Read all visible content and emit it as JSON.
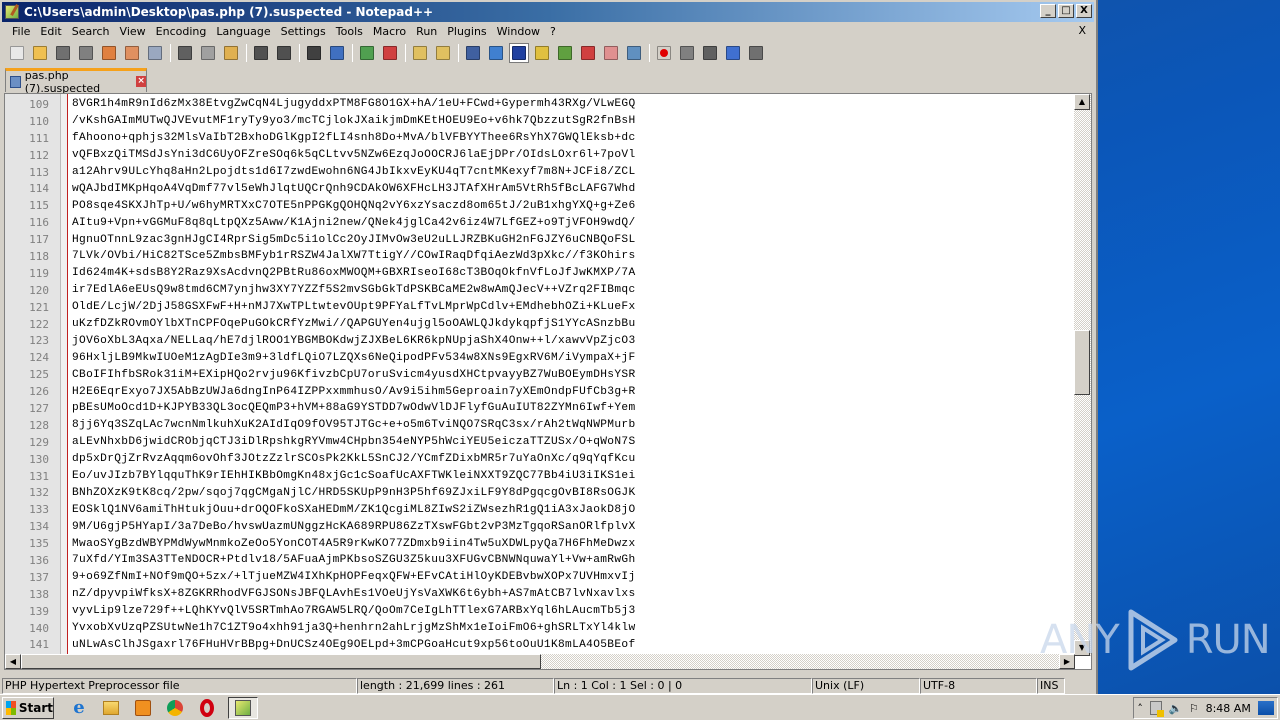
{
  "window": {
    "title": "C:\\Users\\admin\\Desktop\\pas.php (7).suspected - Notepad++",
    "buttons": {
      "minimize": "_",
      "maximize": "□",
      "close": "X"
    }
  },
  "menubar": {
    "items": [
      "File",
      "Edit",
      "Search",
      "View",
      "Encoding",
      "Language",
      "Settings",
      "Tools",
      "Macro",
      "Run",
      "Plugins",
      "Window",
      "?"
    ],
    "close_doc": "X"
  },
  "toolbar": {
    "icons": [
      {
        "name": "new-file-icon",
        "color": "#e8e8e8"
      },
      {
        "name": "open-file-icon",
        "color": "#f0c050"
      },
      {
        "name": "save-icon",
        "color": "#707070"
      },
      {
        "name": "save-all-icon",
        "color": "#808080"
      },
      {
        "name": "close-icon",
        "color": "#e08040"
      },
      {
        "name": "close-all-icon",
        "color": "#e09060"
      },
      {
        "name": "print-icon",
        "color": "#9aa8c0"
      },
      {
        "sep": true
      },
      {
        "name": "cut-icon",
        "color": "#606060"
      },
      {
        "name": "copy-icon",
        "color": "#a0a0a0"
      },
      {
        "name": "paste-icon",
        "color": "#e0b050"
      },
      {
        "sep": true
      },
      {
        "name": "undo-icon",
        "color": "#505050"
      },
      {
        "name": "redo-icon",
        "color": "#505050"
      },
      {
        "sep": true
      },
      {
        "name": "find-icon",
        "color": "#404040"
      },
      {
        "name": "replace-icon",
        "color": "#4070c0"
      },
      {
        "sep": true
      },
      {
        "name": "zoom-in-icon",
        "color": "#50a050"
      },
      {
        "name": "zoom-out-icon",
        "color": "#d04040"
      },
      {
        "sep": true
      },
      {
        "name": "sync-vertical-icon",
        "color": "#e0c060"
      },
      {
        "name": "sync-horizontal-icon",
        "color": "#e0c060"
      },
      {
        "sep": true
      },
      {
        "name": "word-wrap-icon",
        "color": "#4060a0"
      },
      {
        "name": "show-all-chars-icon",
        "color": "#4080d0"
      },
      {
        "name": "indent-guide-icon",
        "color": "#2040a0",
        "active": true
      },
      {
        "name": "user-defined-language-icon",
        "color": "#e0c040"
      },
      {
        "name": "document-map-icon",
        "color": "#60a040"
      },
      {
        "name": "function-list-icon",
        "color": "#d04040"
      },
      {
        "name": "folder-workspace-icon",
        "color": "#e09090"
      },
      {
        "name": "monitoring-icon",
        "color": "#6090c0"
      },
      {
        "sep": true
      },
      {
        "name": "record-macro-icon",
        "color": "#e00000"
      },
      {
        "name": "stop-macro-icon",
        "color": "#808080"
      },
      {
        "name": "play-macro-icon",
        "color": "#606060"
      },
      {
        "name": "run-macro-multiple-icon",
        "color": "#4070d0"
      },
      {
        "name": "save-macro-icon",
        "color": "#707070"
      }
    ]
  },
  "tab": {
    "label": "pas.php (7).suspected",
    "close": "×"
  },
  "editor": {
    "lines": [
      {
        "n": "109",
        "text": "8VGR1h4mR9nId6zMx38EtvgZwCqN4LjugyddxPTM8FG8O1GX+hA/1eU+FCwd+Gypermh43RXg/VLwEGQ"
      },
      {
        "n": "110",
        "text": "/vKshGAImMUTwQJVEvutMF1ryTy9yo3/mcTCjlokJXaikjmDmKEtHOEU9Eo+v6hk7QbzzutSgR2fnBsH"
      },
      {
        "n": "111",
        "text": "fAhoono+qphjs32MlsVaIbT2BxhoDGlKgpI2fLI4snh8Do+MvA/blVFBYYThee6RsYhX7GWQlEksb+dc"
      },
      {
        "n": "112",
        "text": "vQFBxzQiTMSdJsYni3dC6UyOFZreSOq6k5qCLtvv5NZw6EzqJoOOCRJ6laEjDPr/OIdsLOxr6l+7poVl"
      },
      {
        "n": "113",
        "text": "a12Ahrv9ULcYhq8aHn2Lpojdts1d6I7zwdEwohn6NG4JbIkxvEyKU4qT7cntMKexyf7m8N+JCFi8/ZCL"
      },
      {
        "n": "114",
        "text": "wQAJbdIMKpHqoA4VqDmf77vl5eWhJlqtUQCrQnh9CDAkOW6XFHcLH3JTAfXHrAm5VtRh5fBcLAFG7Whd"
      },
      {
        "n": "115",
        "text": "PO8sqe4SKXJhTp+U/w6hyMRTXxC7OTE5nPPGKgQOHQNq2vY6xzYsaczd8om65tJ/2uB1xhgYXQ+g+Ze6"
      },
      {
        "n": "116",
        "text": "AItu9+Vpn+vGGMuF8q8qLtpQXz5Aww/K1Ajni2new/QNek4jglCa42v6iz4W7LfGEZ+o9TjVFOH9wdQ/"
      },
      {
        "n": "117",
        "text": "HgnuOTnnL9zac3gnHJgCI4RprSig5mDc5i1olCc2OyJIMvOw3eU2uLLJRZBKuGH2nFGJZY6uCNBQoFSL"
      },
      {
        "n": "118",
        "text": "7LVk/OVbi/HiC82TSce5ZmbsBMFyb1rRSZW4JalXW7TtigY//COwIRaqDfqiAezWd3pXkc//f3KOhirs"
      },
      {
        "n": "119",
        "text": "Id624m4K+sdsB8Y2Raz9XsAcdvnQ2PBtRu86oxMWOQM+GBXRIseoI68cT3BOqOkfnVfLoJfJwKMXP/7A"
      },
      {
        "n": "120",
        "text": "ir7EdlA6eEUsQ9w8tmd6CM7ynjhw3XY7YZZf5S2mvSGbGkTdPSKBCaME2w8wAmQJecV++VZrq2FIBmqc"
      },
      {
        "n": "121",
        "text": "OldE/LcjW/2DjJ58GSXFwF+H+nMJ7XwTPLtwtevOUpt9PFYaLfTvLMprWpCdlv+EMdhebhOZi+KLueFx"
      },
      {
        "n": "122",
        "text": "uKzfDZkROvmOYlbXTnCPFOqePuGOkCRfYzMwi//QAPGUYen4ujgl5oOAWLQJkdykqpfjS1YYcASnzbBu"
      },
      {
        "n": "123",
        "text": "jOV6oXbL3Aqxa/NELLaq/hE7djlROO1YBGMBOKdwjZJXBeL6KR6kpNUpjaShX4Onw++l/xawvVpZjcO3"
      },
      {
        "n": "124",
        "text": "96HxljLB9MkwIUOeM1zAgDIe3m9+3ldfLQiO7LZQXs6NeQipodPFv534w8XNs9EgxRV6M/iVympaX+jF"
      },
      {
        "n": "125",
        "text": "CBoIFIhfbSRok31iM+EXipHQo2rvju96KfivzbCpU7oruSvicm4yusdXHCtpvayyBZ7WuBOEymDHsYSR"
      },
      {
        "n": "126",
        "text": "H2E6EqrExyo7JX5AbBzUWJa6dngInP64IZPPxxmmhusO/Av9i5ihm5Geproain7yXEmOndpFUfCb3g+R"
      },
      {
        "n": "127",
        "text": "pBEsUMoOcd1D+KJPYB33QL3ocQEQmP3+hVM+88aG9YSTDD7wOdwVlDJFlyfGuAuIUT82ZYMn6Iwf+Yem"
      },
      {
        "n": "128",
        "text": "8jj6Yq3SZqLAc7wcnNmlkuhXuK2AIdIqO9fOV95TJTGc+e+o5m6TviNQO7SRqC3sx/rAh2tWqNWPMurb"
      },
      {
        "n": "129",
        "text": "aLEvNhxbD6jwidCRObjqCTJ3iDlRpshkgRYVmw4CHpbn354eNYP5hWciYEU5eiczaTTZUSx/O+qWoN7S"
      },
      {
        "n": "130",
        "text": "dp5xDrQjZrRvzAqqm6ovOhf3JOtzZzlrSCOsPk2KkL5SnCJ2/YCmfZDixbMR5r7uYaOnXc/q9qYqfKcu"
      },
      {
        "n": "131",
        "text": "Eo/uvJIzb7BYlqquThK9rIEhHIKBbOmgKn48xjGc1cSoafUcAXFTWKleiNXXT9ZQC77Bb4iU3iIKS1ei"
      },
      {
        "n": "132",
        "text": "BNhZOXzK9tK8cq/2pw/sqoj7qgCMgaNjlC/HRD5SKUpP9nH3P5hf69ZJxiLF9Y8dPgqcgOvBI8RsOGJK"
      },
      {
        "n": "133",
        "text": "EOSklQ1NV6amiThHtukjOuu+drOQOFkoSXaHEDmM/ZK1QcgiML8ZIwS2iZWsezhR1gQ1iA3xJaokD8jO"
      },
      {
        "n": "134",
        "text": "9M/U6gjP5HYapI/3a7DeBo/hvswUazmUNggzHcKA689RPU86ZzTXswFGbt2vP3MzTgqoRSanORlfplvX"
      },
      {
        "n": "135",
        "text": "MwaoSYgBzdWBYPMdWywMnmkoZeOo5YonCOT4A5R9rKwKO77ZDmxb9iin4Tw5uXDWLpyQa7H6FhMeDwzx"
      },
      {
        "n": "136",
        "text": "7uXfd/YIm3SA3TTeNDOCR+Ptdlv18/5AFuaAjmPKbsoSZGU3Z5kuu3XFUGvCBNWNquwaYl+Vw+amRwGh"
      },
      {
        "n": "137",
        "text": "9+o69ZfNmI+NOf9mQO+5zx/+lTjueMZW4IXhKpHOPFeqxQFW+EFvCAtiHlOyKDEBvbwXOPx7UVHmxvIj"
      },
      {
        "n": "138",
        "text": "nZ/dpyvpiWfksX+8ZGKRRhodVFGJSONsJBFQLAvhEs1VOeUjYsVaXWK6t6ybh+AS7mAtCB7lvNxavlxs"
      },
      {
        "n": "139",
        "text": "vyvLip9lze729f++LQhKYvQlV5SRTmhAo7RGAW5LRQ/QoOm7CeIgLhTTlexG7ARBxYql6hLAucmTb5j3"
      },
      {
        "n": "140",
        "text": "YvxobXvUzqPZSUtwNe1h7C1ZT9o4xhh91ja3Q+henhrn2ahLrjgMzShMx1eIoiFmO6+ghSRLTxYl4klw"
      },
      {
        "n": "141",
        "text": "uNLwAsClhJSgaxrl76FHuHVrBBpg+DnUCSz4OEg9OELpd+3mCPGoaHcut9xp56toOuU1K8mLA4O5BEof"
      }
    ]
  },
  "statusbar": {
    "file_type": "PHP Hypertext Preprocessor file",
    "length_lines": "length : 21,699    lines : 261",
    "position": "Ln : 1    Col : 1    Sel : 0 | 0",
    "eol": "Unix (LF)",
    "encoding": "UTF-8",
    "mode": "INS"
  },
  "taskbar": {
    "start_label": "Start",
    "clock": "8:48 AM"
  },
  "watermark": {
    "left": "ANY",
    "right": "RUN"
  }
}
